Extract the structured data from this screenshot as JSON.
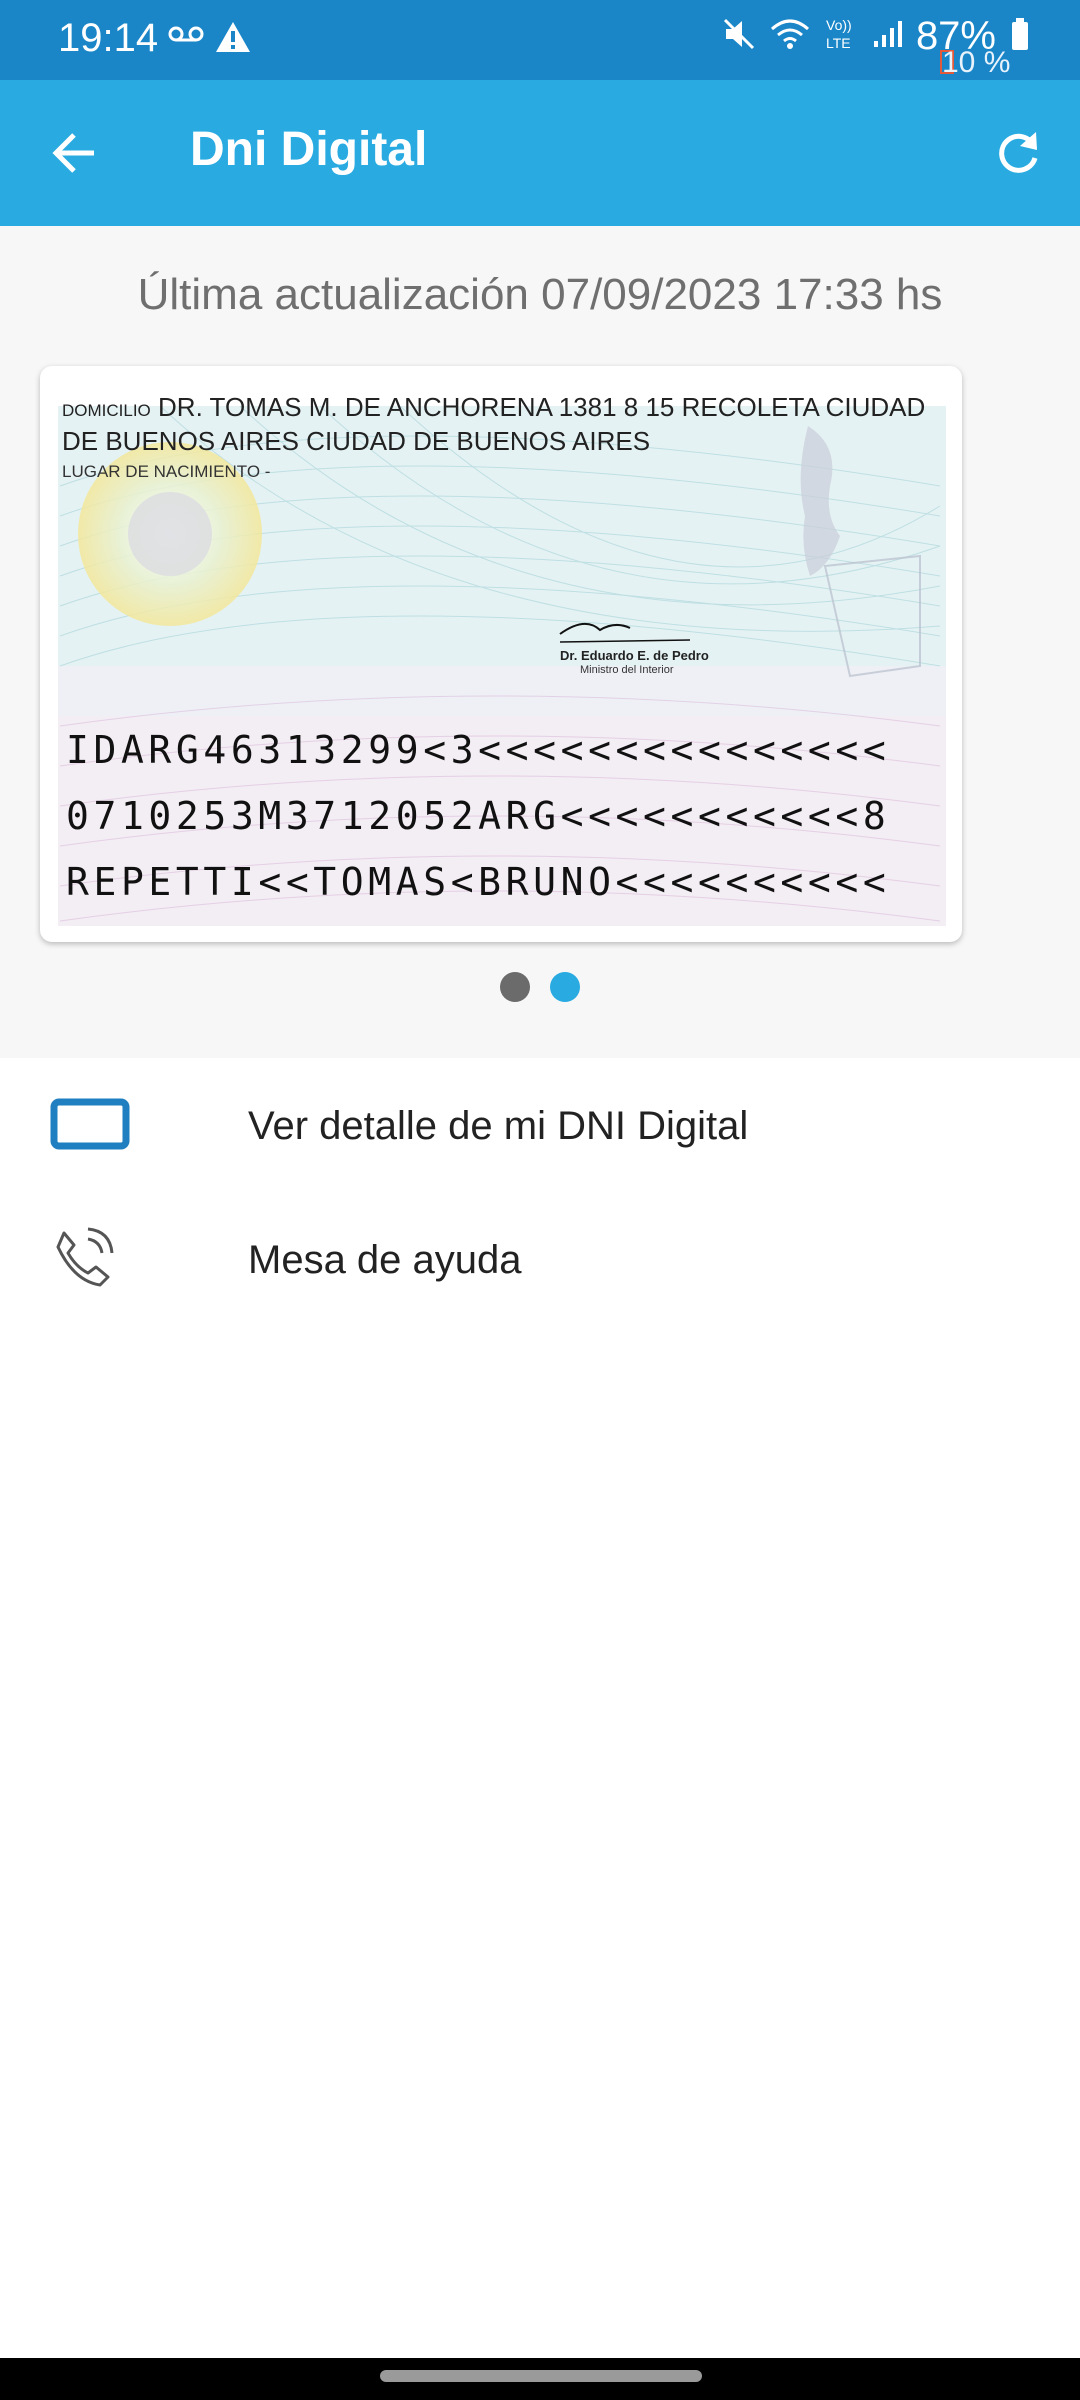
{
  "status_bar": {
    "time": "19:14",
    "battery": "87%",
    "overlay_percent": "10 %",
    "icons": [
      "voicemail-icon",
      "warning-icon",
      "mute-icon",
      "wifi-icon",
      "volte-icon",
      "signal-icon",
      "battery-icon"
    ]
  },
  "app_bar": {
    "title": "Dni Digital",
    "back_icon": "arrow-left-icon",
    "refresh_icon": "refresh-icon",
    "color": "#29abe2"
  },
  "last_update": "Última actualización 07/09/2023 17:33 hs",
  "card": {
    "address_label": "DOMICILIO",
    "address_text": "DR. TOMAS M. DE ANCHORENA 1381 8 15 RECOLETA CIUDAD DE BUENOS AIRES CIUDAD DE BUENOS AIRES",
    "birthplace": "LUGAR DE NACIMIENTO -",
    "signature_name": "Dr. Eduardo E. de Pedro",
    "signature_role": "Ministro del Interior",
    "mrz": [
      "IDARG46313299<3<<<<<<<<<<<<<<<",
      "0710253M3712052ARG<<<<<<<<<<<8",
      "REPETTI<<TOMAS<BRUNO<<<<<<<<<<"
    ]
  },
  "pager": {
    "count": 2,
    "active": 2
  },
  "menu": [
    {
      "label": "Ver detalle de mi DNI Digital",
      "icon": "id-card-icon"
    },
    {
      "label": "Mesa de ayuda",
      "icon": "phone-ringing-icon"
    }
  ]
}
